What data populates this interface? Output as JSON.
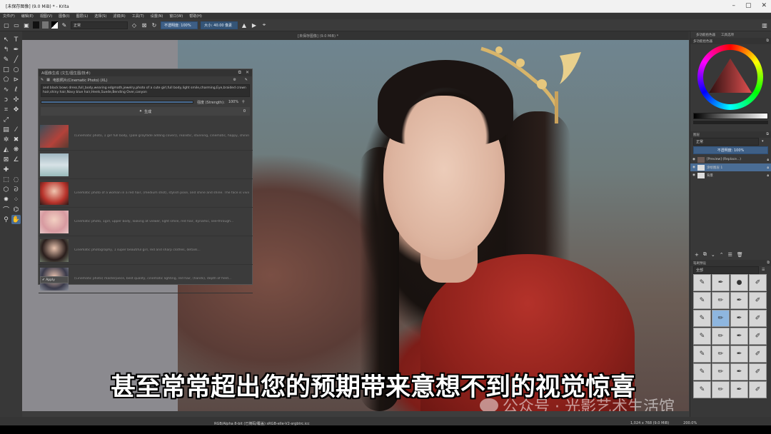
{
  "window": {
    "title": "[未保存图像] (9.0 MiB) * - Krita",
    "controls": [
      "–",
      "▢",
      "✕"
    ]
  },
  "menu": [
    "文件(F)",
    "编辑(E)",
    "视图(V)",
    "图像(I)",
    "图层(L)",
    "选择(S)",
    "滤镜(R)",
    "工具(T)",
    "设置(N)",
    "窗口(W)",
    "帮助(H)"
  ],
  "toolbar": {
    "blend_mode": "正常",
    "opacity_label": "不透明度: 100%",
    "size_label": "大小: 40.00 像素"
  },
  "tab": {
    "label": "[未保存图像] (9.0 MiB) *"
  },
  "docker": {
    "title": "AI图像生成 (文生/图生图/技术)",
    "model_label": "电影照片(Cinematic Photo) (XL)",
    "prompt": "and black bows dress,full_body,wearing edgmath,jewelry,photo of a cute girl,full body,light smile,charming,Eye,braided crown hair,shiny hair,Navy blue hair,Heels,Suede,Bending Over,canyon",
    "strength_label": "强度 (Strength):",
    "strength_value": "100%",
    "strength_fraction": 1.0,
    "generate_label": "生成",
    "queue_count": "0",
    "history": [
      "(Cinematic photo, 1 girl full body, (pale grayfade adding cover)), realistic, stunning, cinematic, happy, shining, ...",
      "",
      "Cinematic photo of a woman in a red hair, (medium shot), stylish pose, and shine and shine. The face is vivid, ...",
      "Cinematic photo, 1girl, upper body, looking at viewer, light smile, red hair, dynamic, see-through...",
      "Cinematic photography, 1 super beautiful girl, red and sharp clothes, details...",
      "(Cinematic photo) masterpiece, best quality, cinematic lighting, red hair, (hands), depth of field..."
    ],
    "apply_label": "✔ Apply"
  },
  "right": {
    "tabs": [
      "多功能拾色器",
      "工具选项"
    ],
    "color_panel_title": "多功能拾色器",
    "layers_title": "图层",
    "layers_mode": "正常",
    "layers_opacity": "不透明度: 100%",
    "layers": [
      {
        "name": "[Preview] (Replace...)"
      },
      {
        "name": "涂绘图层 1"
      },
      {
        "name": "背景"
      }
    ],
    "brush_title": "笔刷预设",
    "brush_filter": "全部"
  },
  "status": {
    "left": "RGB/Alpha 8-bit (已掩码/覆盖)  sRGB-elle-V2-srgbtrc.icc",
    "size": "1,024 x 768 (9.0 MiB)",
    "zoom": "200.0%"
  },
  "subtitle": "甚至常常超出您的预期带来意想不到的视觉惊喜",
  "watermark": "公众号 · 光影艺术生活馆"
}
